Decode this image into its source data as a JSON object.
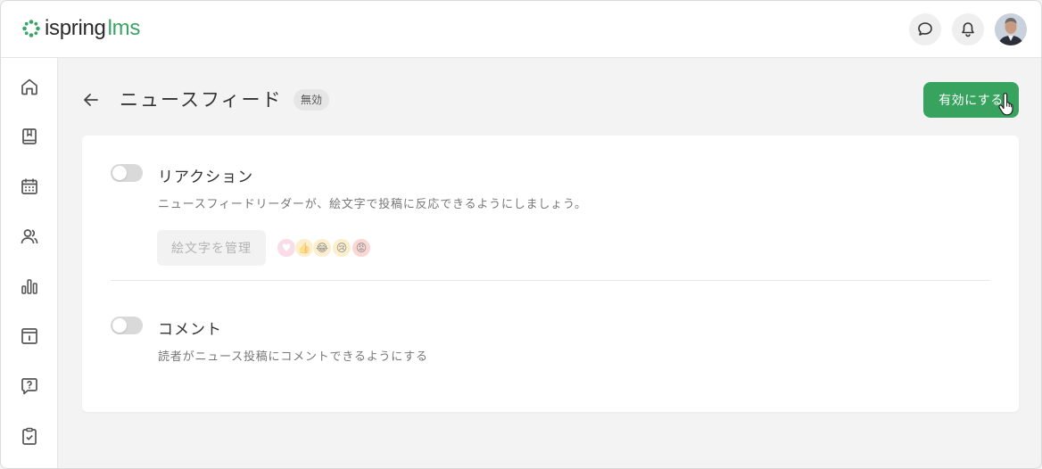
{
  "brand": {
    "logo_part1": "ispring",
    "logo_part2": "lms",
    "green": "#37a35f"
  },
  "topbar": {
    "icons": [
      "chat-icon",
      "bell-icon",
      "avatar"
    ]
  },
  "sidebar": {
    "items": [
      "home-icon",
      "book-icon",
      "calendar-icon",
      "users-icon",
      "reports-icon",
      "info-icon",
      "help-icon",
      "clipboard-icon"
    ]
  },
  "header": {
    "title": "ニュースフィード",
    "status": "無効",
    "enable_label": "有効にする"
  },
  "reactions": {
    "title": "リアクション",
    "enabled": false,
    "description": "ニュースフィードリーダーが、絵文字で投稿に反応できるようにしましょう。",
    "manage_label": "絵文字を管理",
    "emojis": [
      "♥",
      "👍",
      "😂",
      "😢",
      "😡"
    ]
  },
  "comments": {
    "title": "コメント",
    "enabled": false,
    "description": "読者がニュース投稿にコメントできるようにする"
  }
}
